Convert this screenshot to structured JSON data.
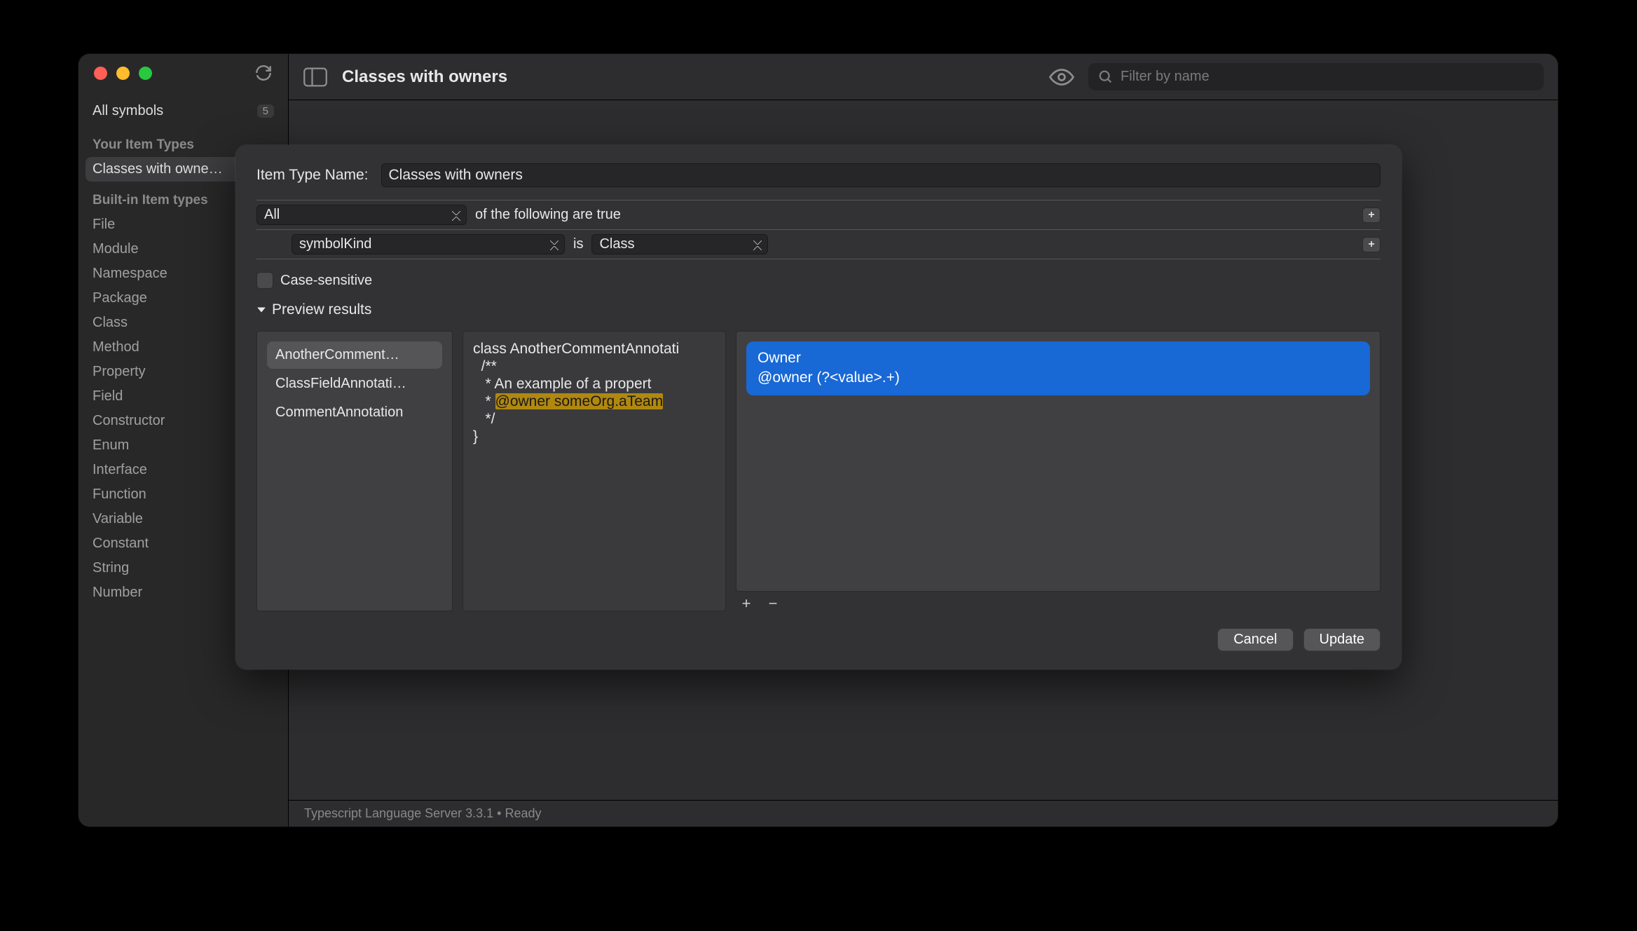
{
  "sidebar": {
    "all_symbols_label": "All symbols",
    "all_symbols_badge": "5",
    "your_item_types_label": "Your Item Types",
    "your_item_types": [
      "Classes with owne…"
    ],
    "builtin_label": "Built-in Item types",
    "builtin_items": [
      "File",
      "Module",
      "Namespace",
      "Package",
      "Class",
      "Method",
      "Property",
      "Field",
      "Constructor",
      "Enum",
      "Interface",
      "Function",
      "Variable",
      "Constant",
      "String",
      "Number"
    ]
  },
  "header": {
    "title": "Classes with owners",
    "search_placeholder": "Filter by name"
  },
  "dialog": {
    "name_label": "Item Type Name:",
    "name_value": "Classes with owners",
    "quantifier": "All",
    "quantifier_suffix": "of the following are true",
    "rule_field": "symbolKind",
    "rule_op": "is",
    "rule_value": "Class",
    "case_sensitive_label": "Case-sensitive",
    "preview_label": "Preview results",
    "preview_items": [
      "AnotherComment…",
      "ClassFieldAnnotati…",
      "CommentAnnotation"
    ],
    "code_lines": [
      "class AnotherCommentAnnotati",
      "  /**",
      "   * An example of a propert",
      "   * ",
      "   */",
      "}"
    ],
    "code_highlight": "@owner someOrg.aTeam",
    "owner_title": "Owner",
    "owner_pattern": "@owner (?<value>.+)",
    "cancel_label": "Cancel",
    "update_label": "Update"
  },
  "status": "Typescript Language Server 3.3.1 • Ready"
}
